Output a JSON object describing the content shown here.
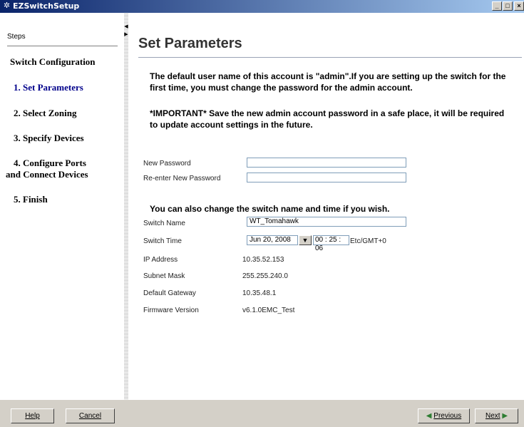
{
  "window": {
    "title": "EZSwitchSetup"
  },
  "sidebar": {
    "header": "Steps",
    "section": "Switch Configuration",
    "items": [
      {
        "label": "1. Set Parameters"
      },
      {
        "label": "2. Select Zoning"
      },
      {
        "label": "3. Specify Devices"
      },
      {
        "label": "4. Configure Ports"
      },
      {
        "label": "and Connect Devices"
      },
      {
        "label": "5. Finish"
      }
    ]
  },
  "main": {
    "title": "Set Parameters",
    "para1": "The default user name of this account is \"admin\".If you are setting up the switch for the first time, you must change the password for the admin account.",
    "para2": "*IMPORTANT* Save the new admin account password in a safe place, it will be required to update account settings in the future.",
    "new_password_label": "New Password",
    "new_password_value": "",
    "reenter_password_label": "Re-enter New Password",
    "reenter_password_value": "",
    "subheading": "You can also change the switch name and time if you wish.",
    "switch_name_label": "Switch Name",
    "switch_name_value": "WT_Tomahawk",
    "switch_time_label": "Switch Time",
    "switch_date_value": "Jun 20, 2008",
    "time_h": "00",
    "time_m": "25",
    "time_s": "06",
    "timezone": "Etc/GMT+0",
    "ip_label": "IP Address",
    "ip_value": "10.35.52.153",
    "subnet_label": "Subnet Mask",
    "subnet_value": "255.255.240.0",
    "gateway_label": "Default Gateway",
    "gateway_value": "10.35.48.1",
    "firmware_label": "Firmware Version",
    "firmware_value": "v6.1.0EMC_Test"
  },
  "footer": {
    "help": "Help",
    "cancel": "Cancel",
    "previous": "Previous",
    "next": "Next"
  },
  "colors": {
    "titlebar": "#0a246a",
    "active_step": "#00008b",
    "next_arrow": "#2e7d32"
  }
}
